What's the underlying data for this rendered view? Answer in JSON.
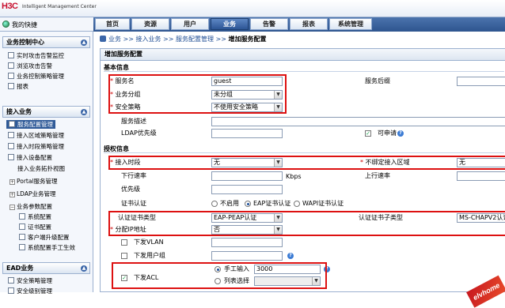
{
  "app": {
    "logo": "H3C",
    "subtitle": "Intelligent Management Center"
  },
  "home": {
    "label": "我的快捷"
  },
  "tabs": [
    {
      "label": "首页"
    },
    {
      "label": "资源"
    },
    {
      "label": "用户"
    },
    {
      "label": "业务"
    },
    {
      "label": "告警"
    },
    {
      "label": "报表"
    },
    {
      "label": "系统管理"
    }
  ],
  "active_tab": "业务",
  "sidebar": {
    "sec1": {
      "title": "业务控制中心",
      "items": [
        "实时攻击告警监控",
        "浏览攻击告警",
        "业务控制策略管理",
        "报表"
      ]
    },
    "sec2": {
      "title": "接入业务",
      "items": [
        "服务配置管理",
        "接入区域策略管理",
        "接入时段策略管理",
        "接入设备配置",
        "接入业务拓扑视图",
        "Portal服务管理",
        "LDAP业务管理",
        "业务参数配置",
        "系统配置",
        "证书配置",
        "客户端升级配置",
        "系统配置手工生效"
      ]
    },
    "sec3": {
      "title": "EAD业务",
      "items": [
        "安全策略管理",
        "安全级别管理"
      ]
    }
  },
  "breadcrumb": {
    "p1": "业务",
    "p2": "接入业务",
    "p3": "服务配置管理",
    "p4": "增加服务配置",
    "sep": ">>"
  },
  "panel": {
    "title": "增加服务配置"
  },
  "basic": {
    "title": "基本信息",
    "service_name_label": "服务名",
    "service_name": "guest",
    "suffix_label": "服务后缀",
    "group_label": "业务分组",
    "group_value": "未分组",
    "security_label": "安全策略",
    "security_value": "不使用安全策略",
    "desc_label": "服务描述",
    "ldap_label": "LDAP优先级",
    "apply_label": "可申请"
  },
  "auth": {
    "title": "授权信息",
    "period_label": "接入时段",
    "period_value": "无",
    "unbound_label": "不绑定接入区域",
    "unbound_value": "无",
    "down_rate_label": "下行速率",
    "rate_unit": "Kbps",
    "up_rate_label": "上行速率",
    "priority_label": "优先级",
    "cert_auth_label": "证书认证",
    "cert_opt1": "不启用",
    "cert_opt2": "EAP证书认证",
    "cert_opt3": "WAPI证书认证",
    "cert_type_label": "认证证书类型",
    "cert_type_value": "EAP-PEAP认证",
    "cert_sub_label": "认证证书子类型",
    "cert_sub_value": "MS-CHAPV2认证",
    "ip_label": "分配IP地址",
    "ip_value": "否",
    "vlan_label": "下发VLAN",
    "usergroup_label": "下发用户组",
    "acl_label": "下发ACL",
    "manual_label": "手工输入",
    "manual_value": "3000",
    "list_label": "列表选择"
  },
  "watermark": "elvhome"
}
